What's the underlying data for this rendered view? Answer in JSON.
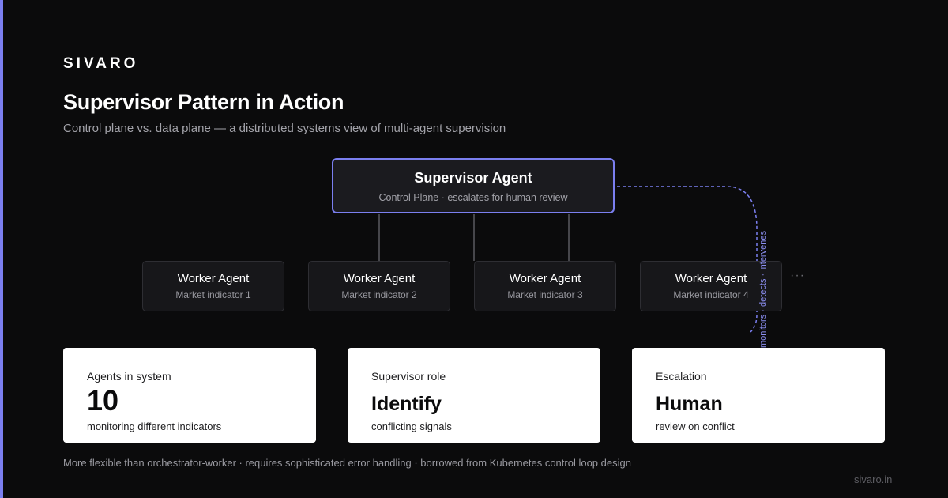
{
  "brand": "SIVARO",
  "title": "Supervisor Pattern in Action",
  "subtitle": "Control plane vs. data plane — a distributed systems view of multi-agent supervision",
  "colors": {
    "accent": "#7b7ff0",
    "background": "#0b0b0c",
    "card": "#ffffff"
  },
  "supervisor": {
    "title": "Supervisor Agent",
    "subtitle": "Control Plane · escalates for human review"
  },
  "workers": [
    {
      "title": "Worker Agent",
      "subtitle": "Market indicator 1"
    },
    {
      "title": "Worker Agent",
      "subtitle": "Market indicator 2"
    },
    {
      "title": "Worker Agent",
      "subtitle": "Market indicator 3"
    },
    {
      "title": "Worker Agent",
      "subtitle": "Market indicator 4"
    }
  ],
  "more_indicator": "···",
  "loop_label": "monitors · detects · intervenes",
  "stats": [
    {
      "label": "Agents in system",
      "value": "10",
      "description": "monitoring different indicators"
    },
    {
      "label": "Supervisor role",
      "value": "Identify",
      "description": "conflicting signals"
    },
    {
      "label": "Escalation",
      "value": "Human",
      "description": "review on conflict"
    }
  ],
  "footnote": "More flexible than orchestrator-worker · requires sophisticated error handling · borrowed from Kubernetes control loop design",
  "site": "sivaro.in"
}
